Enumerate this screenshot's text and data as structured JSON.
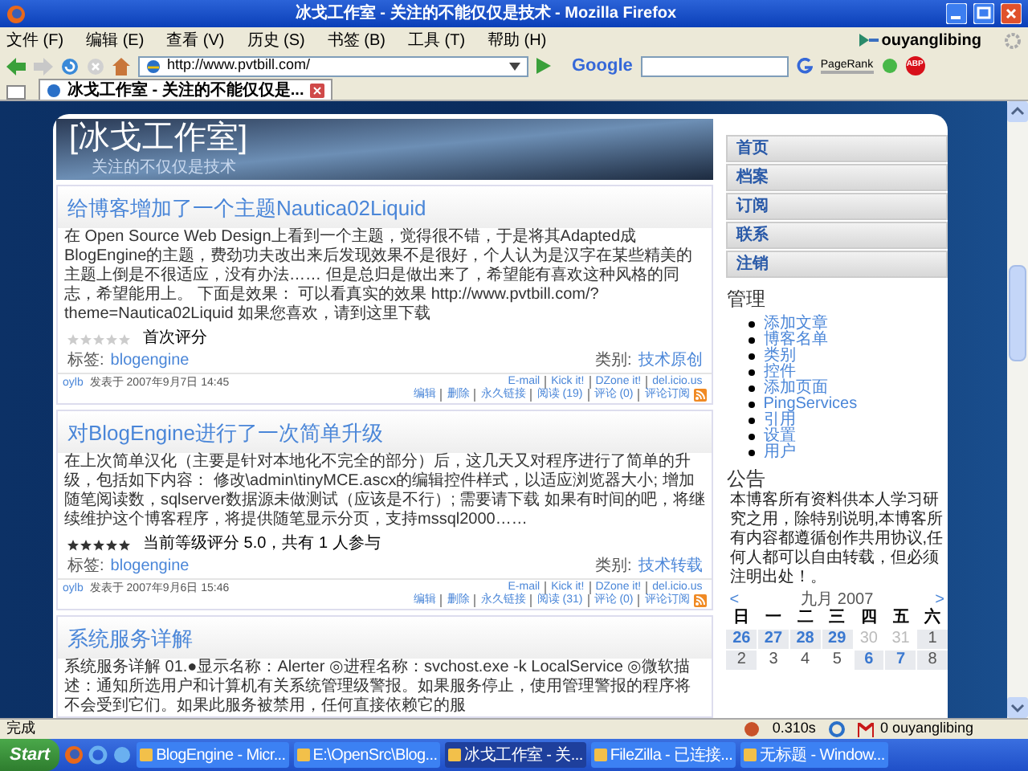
{
  "window": {
    "title": "冰戈工作室 - 关注的不能仅仅是技术 - Mozilla Firefox"
  },
  "menu": [
    "文件 (F)",
    "编辑 (E)",
    "查看 (V)",
    "历史 (S)",
    "书签 (B)",
    "工具 (T)",
    "帮助 (H)"
  ],
  "account": "ouyanglibing",
  "address": {
    "value": "http://www.pvtbill.com/"
  },
  "search_engine": "Google",
  "pagerank_label": "PageRank",
  "adblock_label": "ABP",
  "tabs": [
    {
      "label": "冰戈工作室 - 关注的不能仅仅是...",
      "selected": true
    }
  ],
  "header": {
    "title": "[冰戈工作室]",
    "subtitle": "关注的不仅仅是技术"
  },
  "posts": [
    {
      "title": "给博客增加了一个主题Nautica02Liquid",
      "body": "在 Open Source Web Design上看到一个主题，觉得很不错，于是将其Adapted成BlogEngine的主题，费劲功夫改出来后发现效果不是很好，个人认为是汉字在某些精美的主题上倒是不很适应，没有办法…… 但是总归是做出来了，希望能有喜欢这种风格的同志，希望能用上。 下面是效果： 可以看真实的效果 http://www.pvtbill.com/?theme=Nautica02Liquid 如果您喜欢，请到这里下载",
      "stars": 0,
      "rating": "首次评分",
      "tags_label": "标签:",
      "tag": "blogengine",
      "category_label": "类别:",
      "category": "技术原创",
      "author": "oylb",
      "posted": "发表于 2007年9月7日 14:45",
      "share": [
        "E-mail",
        "Kick it!",
        "DZone it!",
        "del.icio.us"
      ],
      "actions": [
        "编辑",
        "删除",
        "永久链接",
        "阅读 (19)",
        "评论 (0)",
        "评论订阅"
      ]
    },
    {
      "title": "对BlogEngine进行了一次简单升级",
      "body": "在上次简单汉化（主要是针对本地化不完全的部分）后，这几天又对程序进行了简单的升级，包括如下内容： 修改\\admin\\tinyMCE.ascx的编辑控件样式，以适应浏览器大小; 增加随笔阅读数，sqlserver数据源未做测试（应该是不行）; 需要请下载 如果有时间的吧，将继续维护这个博客程序，将提供随笔显示分页，支持mssql2000……",
      "stars": 5,
      "rating": "当前等级评分 5.0，共有 1 人参与",
      "tags_label": "标签:",
      "tag": "blogengine",
      "category_label": "类别:",
      "category": "技术转载",
      "author": "oylb",
      "posted": "发表于 2007年9月6日 15:46",
      "share": [
        "E-mail",
        "Kick it!",
        "DZone it!",
        "del.icio.us"
      ],
      "actions": [
        "编辑",
        "删除",
        "永久链接",
        "阅读 (31)",
        "评论 (0)",
        "评论订阅"
      ]
    },
    {
      "title": "系统服务详解",
      "body": "系统服务详解 01.●显示名称：Alerter ◎进程名称：svchost.exe -k LocalService ◎微软描述：通知所选用户和计算机有关系统管理级警报。如果服务停止，使用管理警报的程序将不会受到它们。如果此服务被禁用，任何直接依赖它的服"
    }
  ],
  "sidebar": {
    "nav": [
      "首页",
      "档案",
      "订阅",
      "联系",
      "注销"
    ],
    "admin_title": "管理",
    "admin_links": [
      "添加文章",
      "博客名单",
      "类别",
      "控件",
      "添加页面",
      "PingServices",
      "引用",
      "设置",
      "用户"
    ],
    "notice_title": "公告",
    "notice": "本博客所有资料供本人学习研究之用，除特别说明,本博客所有内容都遵循创作共用协议,任何人都可以自由转载，但必须注明出处！。",
    "calendar": {
      "prev": "<",
      "month": "九月 2007",
      "next": ">",
      "weekdays": [
        "日",
        "一",
        "二",
        "三",
        "四",
        "五",
        "六"
      ],
      "days": [
        {
          "day": "26",
          "kind": "post"
        },
        {
          "day": "27",
          "kind": "post"
        },
        {
          "day": "28",
          "kind": "post"
        },
        {
          "day": "29",
          "kind": "post"
        },
        {
          "day": "30",
          "kind": "other"
        },
        {
          "day": "31",
          "kind": "other"
        },
        {
          "day": "1",
          "kind": "weekend"
        },
        {
          "day": "2",
          "kind": "weekend"
        },
        {
          "day": "3",
          "kind": "plain"
        },
        {
          "day": "4",
          "kind": "plain"
        },
        {
          "day": "5",
          "kind": "plain"
        },
        {
          "day": "6",
          "kind": "post"
        },
        {
          "day": "7",
          "kind": "post"
        },
        {
          "day": "8",
          "kind": "weekend"
        }
      ]
    }
  },
  "status_bar": {
    "text": "完成",
    "timing": "0.310s",
    "mail": "0 ouyanglibing"
  },
  "taskbar": {
    "start": "Start",
    "tasks": [
      {
        "label": "BlogEngine - Micr...",
        "selected": false
      },
      {
        "label": "E:\\OpenSrc\\Blog...",
        "selected": false
      },
      {
        "label": "冰戈工作室 - 关...",
        "selected": true
      },
      {
        "label": "FileZilla - 已连接...",
        "selected": false
      },
      {
        "label": "无标题 - Window...",
        "selected": false
      }
    ]
  }
}
